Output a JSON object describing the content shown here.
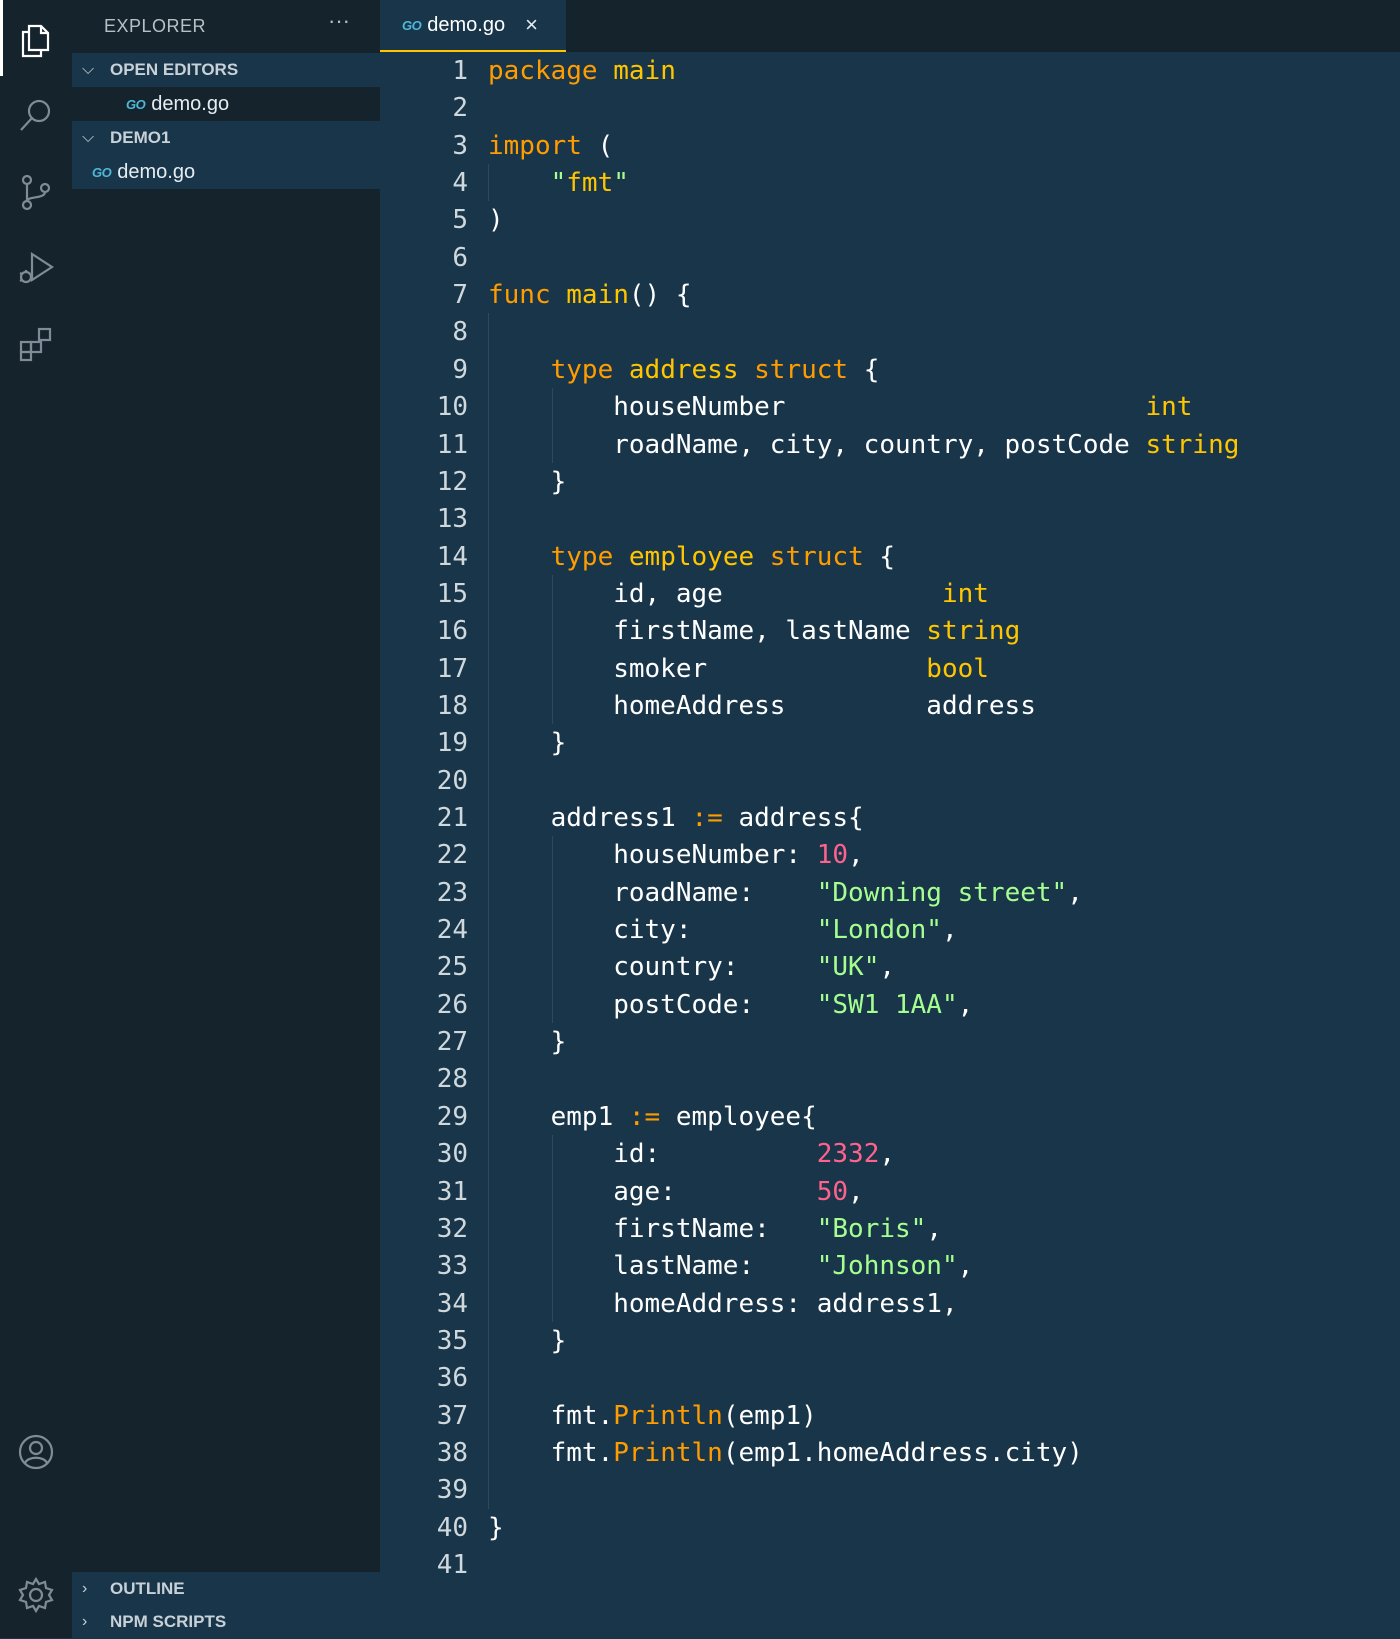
{
  "activity_bar": {
    "icons": [
      "files-icon",
      "search-icon",
      "source-control-icon",
      "run-debug-icon",
      "extensions-icon",
      "account-icon",
      "settings-gear-icon"
    ]
  },
  "sidebar": {
    "title": "EXPLORER",
    "more": "···",
    "open_editors": {
      "label": "OPEN EDITORS",
      "file": "demo.go"
    },
    "project": {
      "label": "DEMO1",
      "file": "demo.go"
    },
    "outline": "OUTLINE",
    "npm_scripts": "NPM SCRIPTS",
    "go_badge": "GO"
  },
  "editor": {
    "tab": {
      "label": "demo.go",
      "close": "×"
    },
    "lines": [
      [
        [
          "kw",
          "package"
        ],
        [
          "pl",
          " "
        ],
        [
          "tp",
          "main"
        ]
      ],
      [],
      [
        [
          "kw",
          "import"
        ],
        [
          "pl",
          " ("
        ]
      ],
      [
        [
          "pl",
          "    "
        ],
        [
          "str",
          "\""
        ],
        [
          "tp",
          "fmt"
        ],
        [
          "str",
          "\""
        ]
      ],
      [
        [
          "pl",
          ")"
        ]
      ],
      [],
      [
        [
          "kw",
          "func"
        ],
        [
          "pl",
          " "
        ],
        [
          "tp",
          "main"
        ],
        [
          "pl",
          "() {"
        ]
      ],
      [],
      [
        [
          "pl",
          "    "
        ],
        [
          "kw",
          "type"
        ],
        [
          "pl",
          " "
        ],
        [
          "tp",
          "address"
        ],
        [
          "pl",
          " "
        ],
        [
          "kw",
          "struct"
        ],
        [
          "pl",
          " {"
        ]
      ],
      [
        [
          "pl",
          "        houseNumber                       "
        ],
        [
          "tp",
          "int"
        ]
      ],
      [
        [
          "pl",
          "        roadName, city, country, postCode "
        ],
        [
          "tp",
          "string"
        ]
      ],
      [
        [
          "pl",
          "    }"
        ]
      ],
      [],
      [
        [
          "pl",
          "    "
        ],
        [
          "kw",
          "type"
        ],
        [
          "pl",
          " "
        ],
        [
          "tp",
          "employee"
        ],
        [
          "pl",
          " "
        ],
        [
          "kw",
          "struct"
        ],
        [
          "pl",
          " {"
        ]
      ],
      [
        [
          "pl",
          "        id, age              "
        ],
        [
          "tp",
          "int"
        ]
      ],
      [
        [
          "pl",
          "        firstName, lastName "
        ],
        [
          "tp",
          "string"
        ]
      ],
      [
        [
          "pl",
          "        smoker              "
        ],
        [
          "tp",
          "bool"
        ]
      ],
      [
        [
          "pl",
          "        homeAddress         address"
        ]
      ],
      [
        [
          "pl",
          "    }"
        ]
      ],
      [],
      [
        [
          "pl",
          "    address1 "
        ],
        [
          "kw",
          ":="
        ],
        [
          "pl",
          " address{"
        ]
      ],
      [
        [
          "pl",
          "        houseNumber: "
        ],
        [
          "num",
          "10"
        ],
        [
          "pl",
          ","
        ]
      ],
      [
        [
          "pl",
          "        roadName:    "
        ],
        [
          "str",
          "\"Downing street\""
        ],
        [
          "pl",
          ","
        ]
      ],
      [
        [
          "pl",
          "        city:        "
        ],
        [
          "str",
          "\"London\""
        ],
        [
          "pl",
          ","
        ]
      ],
      [
        [
          "pl",
          "        country:     "
        ],
        [
          "str",
          "\"UK\""
        ],
        [
          "pl",
          ","
        ]
      ],
      [
        [
          "pl",
          "        postCode:    "
        ],
        [
          "str",
          "\"SW1 1AA\""
        ],
        [
          "pl",
          ","
        ]
      ],
      [
        [
          "pl",
          "    }"
        ]
      ],
      [],
      [
        [
          "pl",
          "    emp1 "
        ],
        [
          "kw",
          ":="
        ],
        [
          "pl",
          " employee{"
        ]
      ],
      [
        [
          "pl",
          "        id:          "
        ],
        [
          "num",
          "2332"
        ],
        [
          "pl",
          ","
        ]
      ],
      [
        [
          "pl",
          "        age:         "
        ],
        [
          "num",
          "50"
        ],
        [
          "pl",
          ","
        ]
      ],
      [
        [
          "pl",
          "        firstName:   "
        ],
        [
          "str",
          "\"Boris\""
        ],
        [
          "pl",
          ","
        ]
      ],
      [
        [
          "pl",
          "        lastName:    "
        ],
        [
          "str",
          "\"Johnson\""
        ],
        [
          "pl",
          ","
        ]
      ],
      [
        [
          "pl",
          "        homeAddress: address1,"
        ]
      ],
      [
        [
          "pl",
          "    }"
        ]
      ],
      [],
      [
        [
          "pl",
          "    fmt."
        ],
        [
          "fn",
          "Println"
        ],
        [
          "pl",
          "(emp1)"
        ]
      ],
      [
        [
          "pl",
          "    fmt."
        ],
        [
          "fn",
          "Println"
        ],
        [
          "pl",
          "(emp1.homeAddress.city)"
        ]
      ],
      [],
      [
        [
          "pl",
          "}"
        ]
      ],
      []
    ]
  }
}
